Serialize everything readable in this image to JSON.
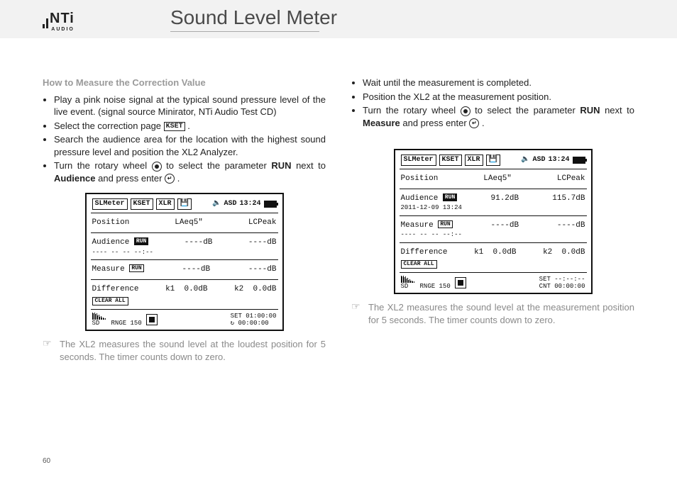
{
  "brand": {
    "name": "NTi",
    "sub": "AUDIO"
  },
  "title": "Sound Level Meter",
  "page_number": "60",
  "colA": {
    "heading": "How to Measure the Correction Value",
    "steps": [
      {
        "text": "Play a pink noise signal at the typical sound pressure level of the live event. (signal source Minirator, NTi Audio Test CD)"
      },
      {
        "text_pre": "Select the correction page ",
        "icon_label": "KSET",
        "text_post": "."
      },
      {
        "text": "Search the audience area for the location with the highest sound pressure level and position the XL2 Analyzer."
      },
      {
        "text_pre": "Turn the rotary wheel ",
        "wheel": true,
        "mid": " to select the parameter ",
        "bold1": "RUN",
        "mid2": " next to ",
        "bold2": "Audience",
        "post": " and press enter ",
        "enter": true,
        "tail": "."
      }
    ],
    "note": "The XL2 measures the sound level at the loudest position for 5 seconds. The timer counts down to zero."
  },
  "colB": {
    "steps": [
      {
        "text": "Wait until the measurement is completed."
      },
      {
        "text": "Position the XL2 at the measurement position."
      },
      {
        "text_pre": "Turn the rotary wheel ",
        "wheel": true,
        "mid": " to select the parameter ",
        "bold1": "RUN",
        "mid2": " next to ",
        "bold2": "Measure",
        "post": " and press enter ",
        "enter": true,
        "tail": "."
      }
    ],
    "note": "The XL2 measures the sound level at the measurement position for 5 seconds. The timer counts down to zero."
  },
  "screen_common": {
    "tabs": [
      "SLMeter",
      "KSET",
      "XLR"
    ],
    "asd": "ASD",
    "time": "13:24",
    "headers": {
      "position": "Position",
      "laeq": "LAeq5\"",
      "lcpeak": "LCPeak"
    },
    "rows": {
      "audience_label": "Audience",
      "measure_label": "Measure",
      "difference_label": "Difference",
      "clear_all": "CLEAR ALL",
      "k1": "k1",
      "k2": "k2"
    },
    "footer": {
      "sd": "SD",
      "range": "RNGE 150",
      "set": "SET"
    }
  },
  "screenA": {
    "audience_run_inverted": true,
    "audience_sub": "---- -- --  --:--",
    "audience_laeq": "----dB",
    "audience_lcpeak": "----dB",
    "measure_run_inverted": false,
    "measure_sub": "",
    "measure_laeq": "----dB",
    "measure_lcpeak": "----dB",
    "diff_k1": "0.0dB",
    "diff_k2": "0.0dB",
    "footer_line1": "01:00:00",
    "footer_line2": "00:00:00",
    "footer_cnt_label": ""
  },
  "screenB": {
    "audience_run_inverted": true,
    "audience_sub": "2011-12-09  13:24",
    "audience_laeq": "91.2dB",
    "audience_lcpeak": "115.7dB",
    "measure_run_inverted": false,
    "measure_sub": "---- -- --  --:--",
    "measure_laeq": "----dB",
    "measure_lcpeak": "----dB",
    "diff_k1": "0.0dB",
    "diff_k2": "0.0dB",
    "footer_line1": "--:--:--",
    "footer_line2": "00:00:00",
    "footer_cnt_label": "CNT"
  }
}
